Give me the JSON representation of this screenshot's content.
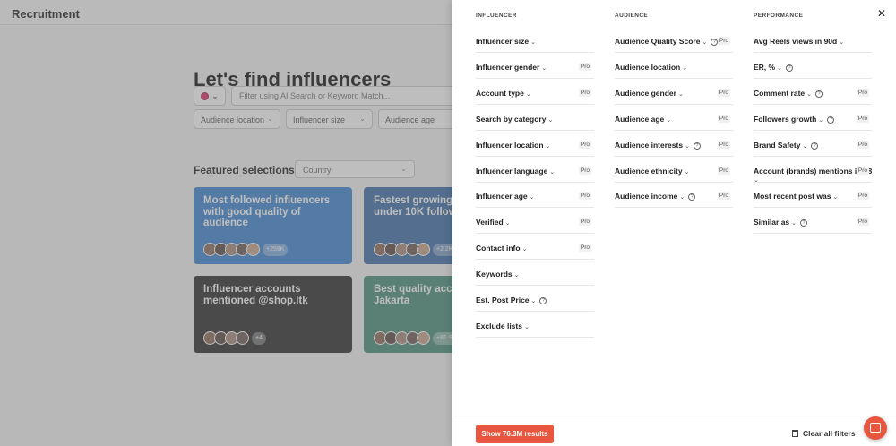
{
  "app": {
    "brand": "Recruitment",
    "hero_title": "Let's find influencers",
    "search_placeholder": "Filter using AI Search or Keyword Match...",
    "filters": [
      "Audience location",
      "Influencer size",
      "Audience age"
    ],
    "featured_title": "Featured selections in",
    "country_placeholder": "Country",
    "cards": [
      {
        "title": "Most followed influencers with good quality of audience",
        "count": "+259K",
        "color": "#3c86d1"
      },
      {
        "title": "Fastest growing influencers under 10K followers",
        "count": "+2.2K",
        "color": "#3d6ea8"
      },
      {
        "title": "Influencer accounts mentioned @shop.ltk",
        "count": "+4",
        "color": "#2c2c2c"
      },
      {
        "title": "Best quality accounts in Jakarta",
        "count": "+81.9K",
        "color": "#4a8f7d"
      }
    ]
  },
  "panel": {
    "close_icon": "close-icon",
    "pro_label": "Pro",
    "columns": [
      {
        "heading": "INFLUENCER",
        "items": [
          {
            "label": "Influencer size",
            "help": false,
            "pro": false
          },
          {
            "label": "Influencer gender",
            "help": false,
            "pro": true
          },
          {
            "label": "Account type",
            "help": false,
            "pro": true
          },
          {
            "label": "Search by category",
            "help": false,
            "pro": false
          },
          {
            "label": "Influencer location",
            "help": false,
            "pro": true
          },
          {
            "label": "Influencer language",
            "help": false,
            "pro": true
          },
          {
            "label": "Influencer age",
            "help": false,
            "pro": true
          },
          {
            "label": "Verified",
            "help": false,
            "pro": true
          },
          {
            "label": "Contact info",
            "help": false,
            "pro": true
          },
          {
            "label": "Keywords",
            "help": false,
            "pro": false
          },
          {
            "label": "Est. Post Price",
            "help": true,
            "pro": false
          },
          {
            "label": "Exclude lists",
            "help": false,
            "pro": false
          }
        ]
      },
      {
        "heading": "AUDIENCE",
        "items": [
          {
            "label": "Audience Quality Score",
            "help": true,
            "pro": true
          },
          {
            "label": "Audience location",
            "help": false,
            "pro": false
          },
          {
            "label": "Audience gender",
            "help": false,
            "pro": true
          },
          {
            "label": "Audience age",
            "help": false,
            "pro": true
          },
          {
            "label": "Audience interests",
            "help": true,
            "pro": true
          },
          {
            "label": "Audience ethnicity",
            "help": false,
            "pro": true
          },
          {
            "label": "Audience income",
            "help": true,
            "pro": true
          }
        ]
      },
      {
        "heading": "PERFORMANCE",
        "items": [
          {
            "label": "Avg Reels views in 90d",
            "help": false,
            "pro": false
          },
          {
            "label": "ER, %",
            "help": true,
            "pro": false
          },
          {
            "label": "Comment rate",
            "help": true,
            "pro": true
          },
          {
            "label": "Followers growth",
            "help": true,
            "pro": true
          },
          {
            "label": "Brand Safety",
            "help": true,
            "pro": true
          },
          {
            "label": "Account (brands) mentions in 18",
            "help": false,
            "pro": true,
            "wrap_chevron": true
          },
          {
            "label": "Most recent post was",
            "help": false,
            "pro": true
          },
          {
            "label": "Similar as",
            "help": true,
            "pro": true
          }
        ]
      }
    ],
    "show_results": "Show 76.3M results",
    "clear_filters": "Clear all filters"
  }
}
